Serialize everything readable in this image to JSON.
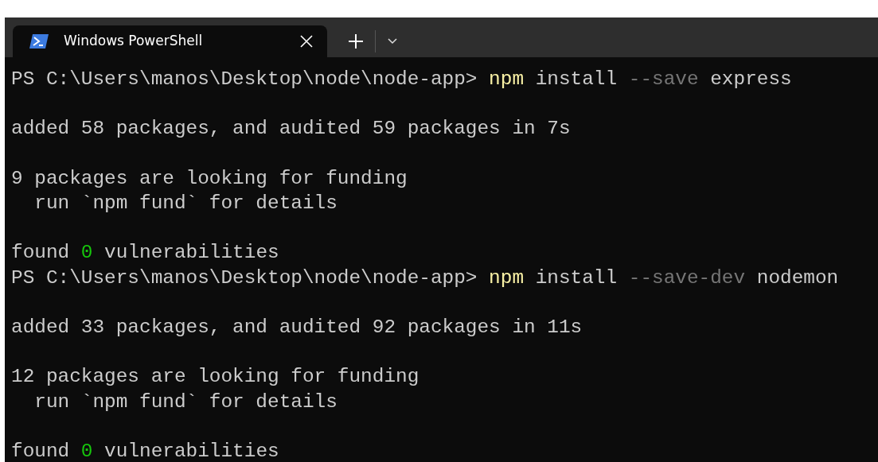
{
  "tab": {
    "title": "Windows PowerShell",
    "selected": true
  },
  "terminal": {
    "blocks": [
      [
        [
          {
            "kind": "plain",
            "text": "PS C:\\Users\\manos\\Desktop\\node\\node-app> "
          },
          {
            "kind": "command",
            "text": "npm"
          },
          {
            "kind": "plain",
            "text": " install "
          },
          {
            "kind": "flag",
            "text": "--save"
          },
          {
            "kind": "plain",
            "text": " express"
          }
        ]
      ],
      [
        [
          {
            "kind": "plain",
            "text": "added 58 packages, and audited 59 packages in 7s"
          }
        ]
      ],
      [
        [
          {
            "kind": "plain",
            "text": "9 packages are looking for funding"
          }
        ],
        [
          {
            "kind": "plain",
            "text": "  run `npm fund` for details"
          }
        ]
      ],
      [
        [
          {
            "kind": "plain",
            "text": "found "
          },
          {
            "kind": "number",
            "text": "0"
          },
          {
            "kind": "plain",
            "text": " vulnerabilities"
          }
        ],
        [
          {
            "kind": "plain",
            "text": "PS C:\\Users\\manos\\Desktop\\node\\node-app> "
          },
          {
            "kind": "command",
            "text": "npm"
          },
          {
            "kind": "plain",
            "text": " install "
          },
          {
            "kind": "flag",
            "text": "--save-dev"
          },
          {
            "kind": "plain",
            "text": " nodemon"
          }
        ]
      ],
      [
        [
          {
            "kind": "plain",
            "text": "added 33 packages, and audited 92 packages in 11s"
          }
        ]
      ],
      [
        [
          {
            "kind": "plain",
            "text": "12 packages are looking for funding"
          }
        ],
        [
          {
            "kind": "plain",
            "text": "  run `npm fund` for details"
          }
        ]
      ],
      [
        [
          {
            "kind": "plain",
            "text": "found "
          },
          {
            "kind": "number",
            "text": "0"
          },
          {
            "kind": "plain",
            "text": " vulnerabilities"
          }
        ]
      ]
    ]
  }
}
